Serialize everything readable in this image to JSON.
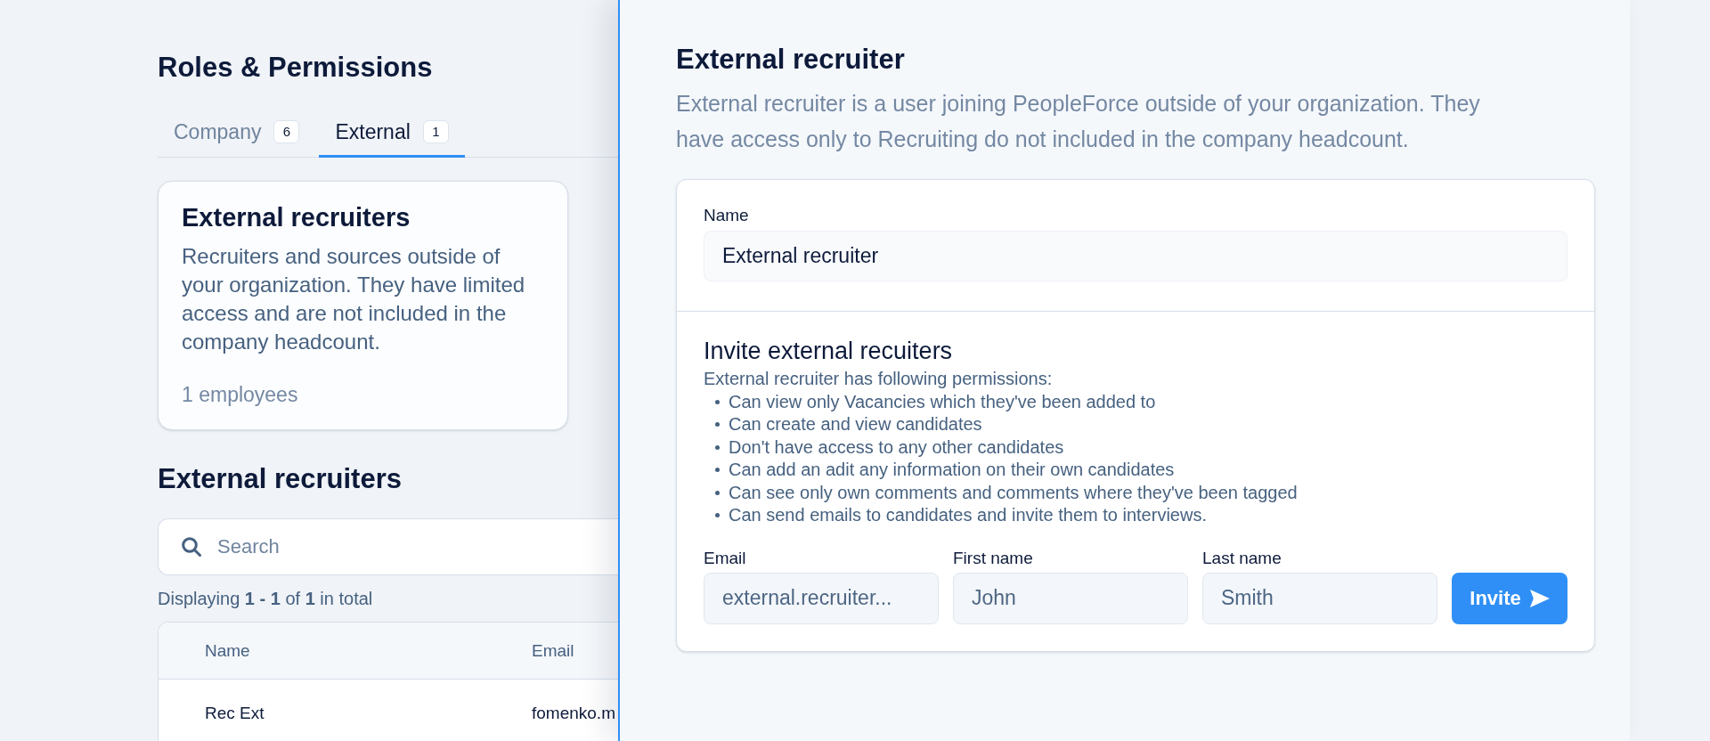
{
  "page": {
    "title": "Roles & Permissions"
  },
  "tabs": [
    {
      "label": "Company",
      "count": "6",
      "selected": false
    },
    {
      "label": "External",
      "count": "1",
      "selected": true
    }
  ],
  "role_card": {
    "title": "External recruiters",
    "description": "Recruiters and sources outside of your organization. They have limited access and are not included in the company headcount.",
    "employees": "1 employees"
  },
  "recruiters": {
    "title": "External recruiters",
    "search": {
      "placeholder": "Search"
    },
    "summary": "Displaying **1 - 1** of **1** in total",
    "table": {
      "columns": [
        "Name",
        "Email"
      ],
      "rows": [
        [
          "Rec Ext",
          "fomenko.m"
        ]
      ]
    }
  },
  "side_panel": {
    "title": "External recruiter",
    "description": "External recruiter is a user joining PeopleForce outside of your organization. They have access only to Recruiting do not included in the company headcount.",
    "name_field": {
      "label": "Name",
      "value": "External recruiter"
    },
    "invite": {
      "title": "Invite external recuiters",
      "intro": "External recruiter has following permissions:",
      "permissions": [
        "Can view only Vacancies which they've been added to",
        "Can create and view candidates",
        "Don't have access to any other candidates",
        "Can add an adit any information on their own candidates",
        "Can see only own comments and comments where they've been tagged",
        "Can send emails to candidates and invite them to interviews."
      ],
      "fields": [
        {
          "label": "Email",
          "placeholder": "external.recruiter..."
        },
        {
          "label": "First name",
          "placeholder": "John"
        },
        {
          "label": "Last name",
          "placeholder": "Smith"
        }
      ],
      "button": "Invite"
    }
  }
}
